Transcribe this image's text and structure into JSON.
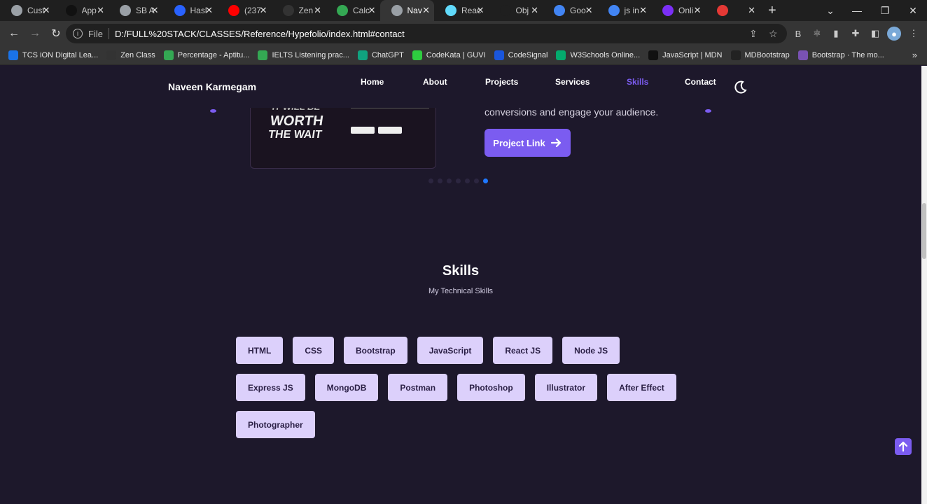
{
  "browser": {
    "tabs": [
      {
        "title": "Cust",
        "color": "#9aa0a6",
        "icon": "globe-icon"
      },
      {
        "title": "App",
        "color": "#111111",
        "icon": "app-icon"
      },
      {
        "title": "SB A",
        "color": "#9aa0a6",
        "icon": "globe-icon"
      },
      {
        "title": "Hasl",
        "color": "#2962ff",
        "icon": "hashnode-icon"
      },
      {
        "title": "(237",
        "color": "#ff0000",
        "icon": "youtube-icon"
      },
      {
        "title": "Zen",
        "color": "#333333",
        "icon": "zen-icon"
      },
      {
        "title": "Calc",
        "color": "#34a853",
        "icon": "sheets-icon"
      },
      {
        "title": "Nav",
        "color": "#9aa0a6",
        "icon": "globe-icon",
        "active": true
      },
      {
        "title": "Reac",
        "color": "#61dafb",
        "icon": "react-icon"
      },
      {
        "title": "Obj",
        "color": "#1f1f1f",
        "icon": "mdn-icon"
      },
      {
        "title": "Goo",
        "color": "#4285f4",
        "icon": "google-icon"
      },
      {
        "title": "js in",
        "color": "#4285f4",
        "icon": "docs-icon"
      },
      {
        "title": "Onli",
        "color": "#7b2ff7",
        "icon": "question-icon"
      },
      {
        "title": "",
        "color": "#e53935",
        "icon": "record-icon"
      }
    ],
    "address": {
      "scheme_label": "File",
      "url": "D:/FULL%20STACK/CLASSES/Reference/Hypefolio/index.html#contact"
    },
    "bookmarks": [
      {
        "label": "TCS iON Digital Lea...",
        "color": "#1a73e8"
      },
      {
        "label": "Zen Class",
        "color": "#333333"
      },
      {
        "label": "Percentage - Aptitu...",
        "color": "#34a853"
      },
      {
        "label": "IELTS Listening prac...",
        "color": "#34a853"
      },
      {
        "label": "ChatGPT",
        "color": "#10a37f"
      },
      {
        "label": "CodeKata | GUVI",
        "color": "#2ecc40"
      },
      {
        "label": "CodeSignal",
        "color": "#1a56db"
      },
      {
        "label": "W3Schools Online...",
        "color": "#04aa6d"
      },
      {
        "label": "JavaScript | MDN",
        "color": "#111111"
      },
      {
        "label": "MDBootstrap",
        "color": "#222222"
      },
      {
        "label": "Bootstrap · The mo...",
        "color": "#7952b3"
      }
    ]
  },
  "site": {
    "brand": "Naveen Karmegam",
    "nav": [
      {
        "label": "Home",
        "active": false
      },
      {
        "label": "About",
        "active": false
      },
      {
        "label": "Projects",
        "active": false
      },
      {
        "label": "Services",
        "active": false
      },
      {
        "label": "Skills",
        "active": true
      },
      {
        "label": "Contact",
        "active": false
      }
    ],
    "project": {
      "image_text": [
        "IT WILL BE",
        "WORTH",
        "THE WAIT"
      ],
      "description_tail": "conversions and engage your audience.",
      "button_label": "Project Link",
      "carousel_count": 7,
      "carousel_active": 6
    },
    "skills_section": {
      "title": "Skills",
      "subtitle": "My Technical Skills",
      "skills": [
        "HTML",
        "CSS",
        "Bootstrap",
        "JavaScript",
        "React JS",
        "Node JS",
        "Express JS",
        "MongoDB",
        "Postman",
        "Photoshop",
        "Illustrator",
        "After Effect",
        "Photographer"
      ]
    }
  }
}
